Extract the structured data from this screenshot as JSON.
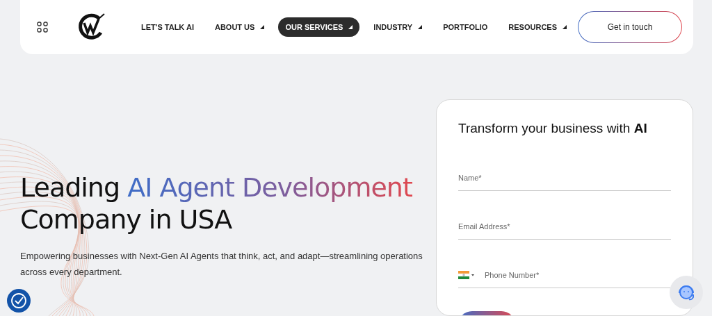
{
  "header": {
    "nav": [
      {
        "label": "LET'S TALK AI",
        "selected": false,
        "dropdown": false
      },
      {
        "label": "ABOUT US",
        "selected": false,
        "dropdown": true
      },
      {
        "label": "OUR SERVICES",
        "selected": true,
        "dropdown": true
      },
      {
        "label": "INDUSTRY",
        "selected": false,
        "dropdown": true
      },
      {
        "label": "PORTFOLIO",
        "selected": false,
        "dropdown": false
      },
      {
        "label": "RESOURCES",
        "selected": false,
        "dropdown": true
      }
    ],
    "cta": "Get in touch"
  },
  "hero": {
    "headline_start": "Leading",
    "headline_highlight": "AI Agent Development",
    "headline_end": "Company in USA",
    "subtitle": "Empowering businesses with Next-Gen AI Agents that think, act, and adapt—streamlining operations across every department."
  },
  "form": {
    "title": "Transform your business with **AI**",
    "fields": [
      {
        "kind": "text",
        "placeholder": "Name*"
      },
      {
        "kind": "text",
        "placeholder": "Email Address*"
      },
      {
        "kind": "phone",
        "placeholder": "Phone Number*"
      }
    ]
  }
}
